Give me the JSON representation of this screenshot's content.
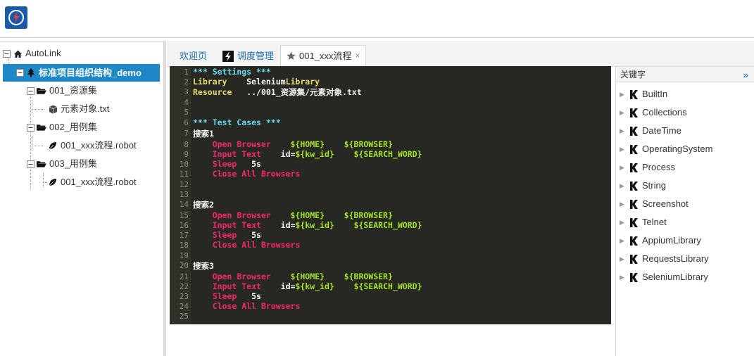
{
  "tree": {
    "root": "AutoLink",
    "project": "标准项目组织结构_demo",
    "items": [
      {
        "label": "001_资源集"
      },
      {
        "label": "元素对象.txt"
      },
      {
        "label": "002_用例集"
      },
      {
        "label": "001_xxx流程.robot"
      },
      {
        "label": "003_用例集"
      },
      {
        "label": "001_xxx流程.robot"
      }
    ]
  },
  "tabs": [
    {
      "label": "欢迎页"
    },
    {
      "label": "调度管理"
    },
    {
      "label": "001_xxx流程",
      "close": "×"
    }
  ],
  "editor": {
    "lines": [
      {
        "n": "1"
      },
      {
        "n": "2"
      },
      {
        "n": "3"
      },
      {
        "n": "4"
      },
      {
        "n": "5"
      },
      {
        "n": "6"
      },
      {
        "n": "7"
      },
      {
        "n": "8"
      },
      {
        "n": "9"
      },
      {
        "n": "10"
      },
      {
        "n": "11"
      },
      {
        "n": "12"
      },
      {
        "n": "13"
      },
      {
        "n": "14"
      },
      {
        "n": "15"
      },
      {
        "n": "16"
      },
      {
        "n": "17"
      },
      {
        "n": "18"
      },
      {
        "n": "19"
      },
      {
        "n": "20"
      },
      {
        "n": "21"
      },
      {
        "n": "22"
      },
      {
        "n": "23"
      },
      {
        "n": "24"
      },
      {
        "n": "25"
      }
    ],
    "settings_header": "*** Settings ***",
    "library_kw": "Library",
    "library_val_a": "Selenium",
    "library_val_b": "Library",
    "resource_kw": "Resource",
    "resource_val": "../001_资源集/元素对象.txt",
    "testcases_header": "*** Test Cases ***",
    "cases": [
      {
        "name": "搜索1"
      },
      {
        "name": "搜索2"
      },
      {
        "name": "搜索3"
      }
    ],
    "open_browser": "Open Browser",
    "home_var": "${HOME}",
    "browser_var": "${BROWSER}",
    "input_text": "Input Text",
    "id_prefix": "id=",
    "kw_id_var": "${kw_id}",
    "search_word_var": "${SEARCH_WORD}",
    "sleep": "Sleep",
    "sleep_val": "5s",
    "close_all": "Close All Browsers"
  },
  "keywords": {
    "title": "关键字",
    "collapse_glyph": "»",
    "items": [
      {
        "label": "BuiltIn"
      },
      {
        "label": "Collections"
      },
      {
        "label": "DateTime"
      },
      {
        "label": "OperatingSystem"
      },
      {
        "label": "Process"
      },
      {
        "label": "String"
      },
      {
        "label": "Screenshot"
      },
      {
        "label": "Telnet"
      },
      {
        "label": "AppiumLibrary"
      },
      {
        "label": "RequestsLibrary"
      },
      {
        "label": "SeleniumLibrary"
      }
    ]
  },
  "colors": {
    "accent": "#1e88c7",
    "editor_bg": "#272822",
    "keyword": "#f92672",
    "variable": "#a6e22e",
    "header": "#66d9ef",
    "setting": "#e6db74"
  },
  "icons": {
    "logo": "autolink-logo-icon",
    "root": "home-icon",
    "project": "tree-icon",
    "folder": "folder-open-icon",
    "resource": "cube-icon",
    "robot": "leaf-icon",
    "scheduler": "lightning-icon",
    "tab_file": "star-icon",
    "library": "k-library-icon"
  }
}
